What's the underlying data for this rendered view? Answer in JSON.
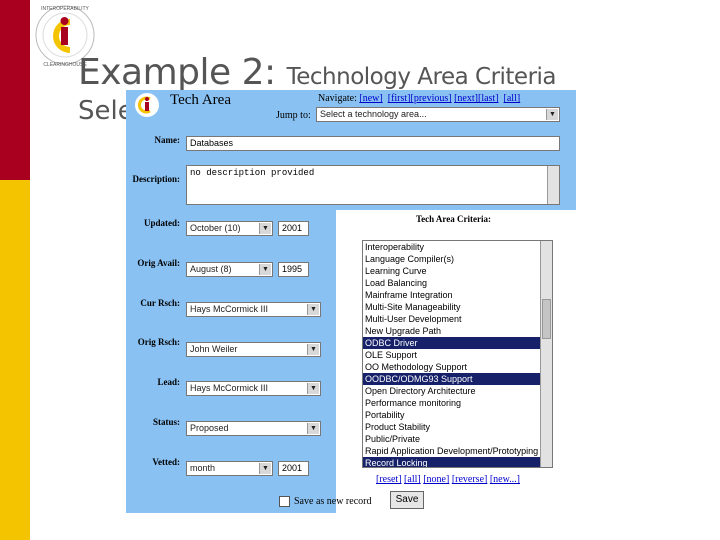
{
  "slide": {
    "title_main": "Example 2:",
    "title_rest": "Technology Area Criteria",
    "title_line2": "Sele"
  },
  "logo": {
    "ring_text": "INTEROPERABILITY CLEARINGHOUSE",
    "letters": "iC"
  },
  "app": {
    "title": "Tech Area",
    "nav": {
      "label": "Navigate:",
      "new": "[new]",
      "first": "[first]",
      "previous": "[previous]",
      "next": "[next]",
      "last": "[last]",
      "all": "[all]"
    },
    "jump": {
      "label": "Jump to:",
      "value": "Select a technology area..."
    },
    "fields": {
      "name": {
        "label": "Name:",
        "value": "Databases"
      },
      "description": {
        "label": "Description:",
        "value": "no description provided"
      },
      "updated": {
        "label": "Updated:",
        "month": "October (10)",
        "year": "2001"
      },
      "orig_avail": {
        "label": "Orig Avail:",
        "month": "August (8)",
        "year": "1995"
      },
      "cur_rsch": {
        "label": "Cur Rsch:",
        "value": "Hays McCormick III"
      },
      "orig_rsch": {
        "label": "Orig Rsch:",
        "value": "John Weiler"
      },
      "lead": {
        "label": "Lead:",
        "value": "Hays McCormick III"
      },
      "status": {
        "label": "Status:",
        "value": "Proposed"
      },
      "vetted": {
        "label": "Vetted:",
        "month": "month",
        "year": "2001"
      }
    },
    "criteria": {
      "title": "Tech Area Criteria:",
      "items": [
        {
          "label": "Interoperability",
          "selected": false
        },
        {
          "label": "Language Compiler(s)",
          "selected": false
        },
        {
          "label": "Learning Curve",
          "selected": false
        },
        {
          "label": "Load Balancing",
          "selected": false
        },
        {
          "label": "Mainframe Integration",
          "selected": false
        },
        {
          "label": "Multi-Site Manageability",
          "selected": false
        },
        {
          "label": "Multi-User Development",
          "selected": false
        },
        {
          "label": "New Upgrade Path",
          "selected": false
        },
        {
          "label": "ODBC Driver",
          "selected": true
        },
        {
          "label": "OLE Support",
          "selected": false
        },
        {
          "label": "OO Methodology Support",
          "selected": false
        },
        {
          "label": "OODBC/ODMG93 Support",
          "selected": true
        },
        {
          "label": "Open Directory Architecture",
          "selected": false
        },
        {
          "label": "Performance monitoring",
          "selected": false
        },
        {
          "label": "Portability",
          "selected": false
        },
        {
          "label": "Product Stability",
          "selected": false
        },
        {
          "label": "Public/Private",
          "selected": false
        },
        {
          "label": "Rapid Application Development/Prototyping",
          "selected": false
        },
        {
          "label": "Record Locking",
          "selected": true
        }
      ],
      "actions": {
        "reset": "[reset]",
        "all": "[all]",
        "none": "[none]",
        "reverse": "[reverse]",
        "new": "[new...]"
      }
    },
    "save_as_new": "Save as new record",
    "save_button": "Save"
  }
}
